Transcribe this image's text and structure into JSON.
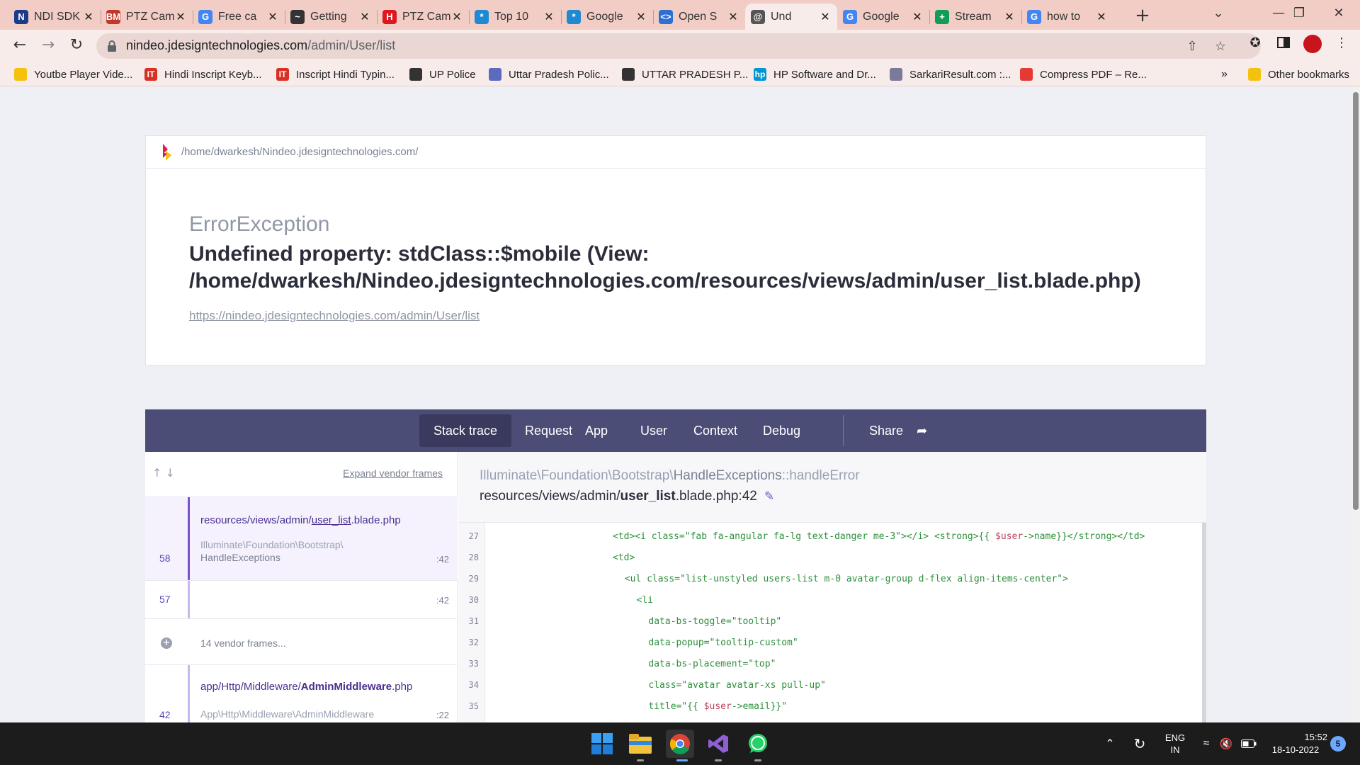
{
  "browser": {
    "tabs": [
      {
        "label": "NDI SDK",
        "icon_text": "N",
        "icon_color": "#1a3a8a"
      },
      {
        "label": "PTZ Cam",
        "icon_text": "BM",
        "icon_color": "#c0392b"
      },
      {
        "label": "Free ca",
        "icon_text": "G",
        "icon_color": "#4285f4"
      },
      {
        "label": "Getting",
        "icon_text": "~",
        "icon_color": "#333333"
      },
      {
        "label": "PTZ Cam",
        "icon_text": "H",
        "icon_color": "#e0161e"
      },
      {
        "label": "Top 10",
        "icon_text": "*",
        "icon_color": "#1f8ad4"
      },
      {
        "label": "Google",
        "icon_text": "*",
        "icon_color": "#1f8ad4"
      },
      {
        "label": "Open S",
        "icon_text": "<>",
        "icon_color": "#2d6fd2"
      },
      {
        "label": "Und",
        "icon_text": "@",
        "icon_color": "#555555"
      },
      {
        "label": "Google",
        "icon_text": "G",
        "icon_color": "#4285f4"
      },
      {
        "label": "Stream",
        "icon_text": "+",
        "icon_color": "#0f9d58"
      },
      {
        "label": "how to",
        "icon_text": "G",
        "icon_color": "#4285f4"
      }
    ],
    "active_tab_index": 8,
    "url_host": "nindeo.jdesigntechnologies.com",
    "url_path": "/admin/User/list",
    "bookmarks": [
      {
        "label": "Youtbe Player Vide...",
        "icon_color": "#f4c20d",
        "icon_text": ""
      },
      {
        "label": "Hindi Inscript Keyb...",
        "icon_color": "#d93025",
        "icon_text": "IT"
      },
      {
        "label": "Inscript Hindi Typin...",
        "icon_color": "#d93025",
        "icon_text": "IT"
      },
      {
        "label": "UP Police",
        "icon_color": "#333333",
        "icon_text": ""
      },
      {
        "label": "Uttar Pradesh Polic...",
        "icon_color": "#5c6bc0",
        "icon_text": ""
      },
      {
        "label": "UTTAR PRADESH P...",
        "icon_color": "#333333",
        "icon_text": ""
      },
      {
        "label": "HP Software and Dr...",
        "icon_color": "#0096d6",
        "icon_text": "hp"
      },
      {
        "label": "SarkariResult.com :...",
        "icon_color": "#7a7a9a",
        "icon_text": ""
      },
      {
        "label": "Compress PDF – Re...",
        "icon_color": "#e53935",
        "icon_text": ""
      }
    ],
    "bookmarks_more": "»",
    "other_bookmarks": "Other bookmarks"
  },
  "error": {
    "path": "/home/dwarkesh/Nindeo.jdesigntechnologies.com/",
    "exception_class": "ErrorException",
    "message": "Undefined property: stdClass::$mobile (View: /home/dwarkesh/Nindeo.jdesigntechnologies.com/resources/views/admin/user_list.blade.php)",
    "url": "https://nindeo.jdesigntechnologies.com/admin/User/list"
  },
  "trace_tabs": [
    "Stack trace",
    "Request",
    "App",
    "User",
    "Context",
    "Debug"
  ],
  "share_label": "Share",
  "expand_vendor": "Expand vendor frames",
  "frames": [
    {
      "num": "58",
      "file_dir": "resources/views/admin/",
      "file_name": "user_list",
      "file_ext": ".blade.php",
      "class": "Illuminate\\Foundation\\Bootstrap\\",
      "method": "HandleExceptions",
      "line": ":42"
    },
    {
      "num": "57",
      "line": ":42"
    },
    {
      "vendor": "14 vendor frames..."
    },
    {
      "num": "42",
      "file_dir": "app/Http/Middleware/",
      "file_name": "AdminMiddleware",
      "file_ext": ".php",
      "class": "App\\Http\\Middleware\\AdminMiddleware",
      "line": ":22"
    }
  ],
  "code_header": {
    "namespace": "Illuminate\\Foundation\\Bootstrap\\",
    "class_name": "HandleExceptions",
    "method": "::handleError",
    "path_dir": "resources/views/admin/",
    "path_file": "user_list",
    "path_rest": ".blade.php:42"
  },
  "code_lines": [
    {
      "n": "27",
      "indent": 20,
      "before": "<td><i class=\"fab fa-angular fa-lg text-danger me-3\"></i> <strong>{{ ",
      "var": "$user",
      "after": "->name}}</strong></td>"
    },
    {
      "n": "28",
      "indent": 20,
      "before": "<td>",
      "var": "",
      "after": ""
    },
    {
      "n": "29",
      "indent": 22,
      "before": "<ul class=\"list-unstyled users-list m-0 avatar-group d-flex align-items-center\">",
      "var": "",
      "after": ""
    },
    {
      "n": "30",
      "indent": 24,
      "before": "<li",
      "var": "",
      "after": ""
    },
    {
      "n": "31",
      "indent": 26,
      "before": "data-bs-toggle=\"tooltip\"",
      "var": "",
      "after": ""
    },
    {
      "n": "32",
      "indent": 26,
      "before": "data-popup=\"tooltip-custom\"",
      "var": "",
      "after": ""
    },
    {
      "n": "33",
      "indent": 26,
      "before": "data-bs-placement=\"top\"",
      "var": "",
      "after": ""
    },
    {
      "n": "34",
      "indent": 26,
      "before": "class=\"avatar avatar-xs pull-up\"",
      "var": "",
      "after": ""
    },
    {
      "n": "35",
      "indent": 26,
      "before": "title=\"{{ ",
      "var": "$user",
      "after": "->email}}\""
    }
  ],
  "taskbar": {
    "lang_top": "ENG",
    "lang_bottom": "IN",
    "time": "15:52",
    "date": "18-10-2022",
    "notif_count": "5"
  },
  "colors": {
    "tab_strip": "#f1cdc5",
    "toolbar": "#f7ecea",
    "page_bg": "#eef0f5",
    "trace_tabs_bg": "#4c4d76",
    "accent": "#7c4fcf"
  }
}
